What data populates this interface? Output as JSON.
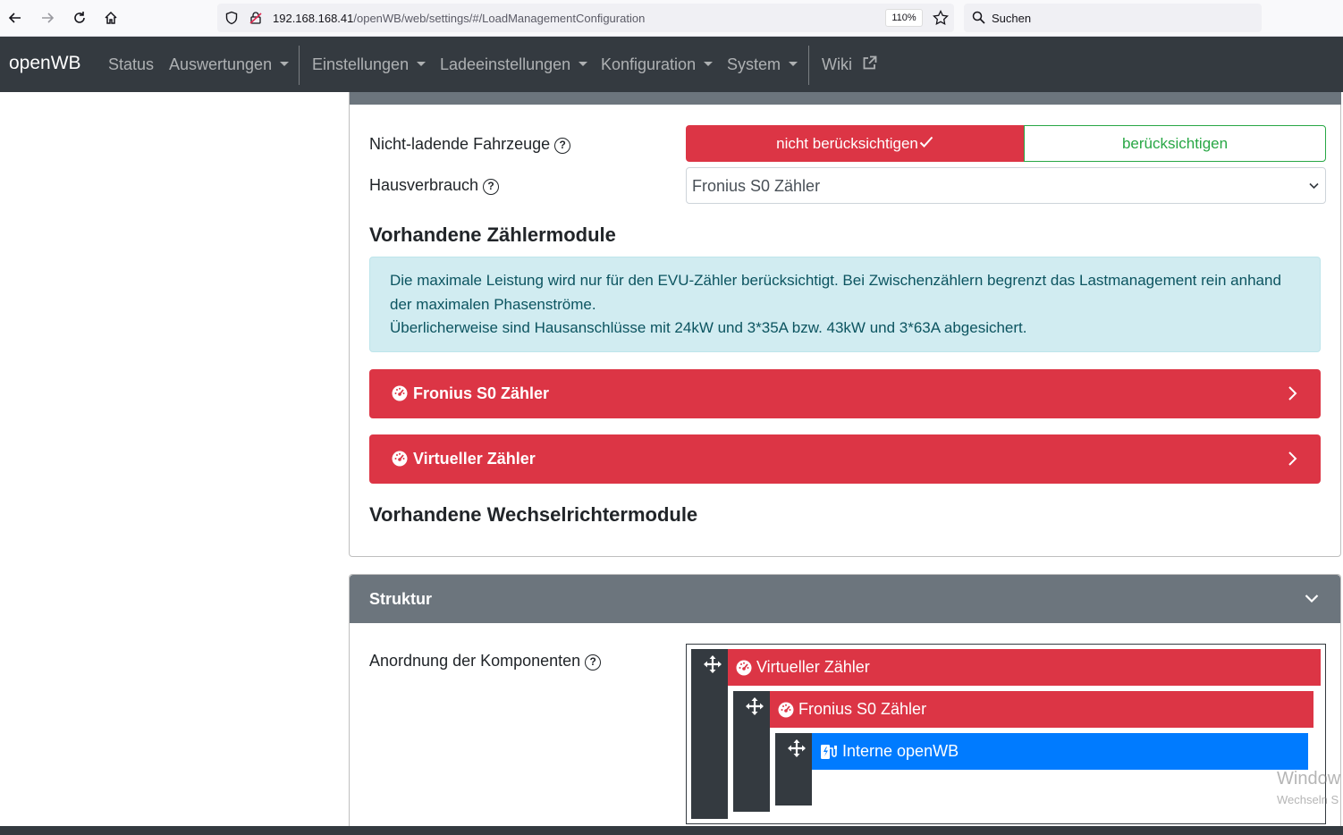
{
  "browser": {
    "url_host": "192.168.168.41",
    "url_path": "/openWB/web/settings/#/LoadManagementConfiguration",
    "zoom": "110%",
    "search_placeholder": "Suchen"
  },
  "navbar": {
    "brand": "openWB",
    "items": [
      {
        "label": "Status"
      },
      {
        "label": "Auswertungen"
      },
      {
        "label": "Einstellungen"
      },
      {
        "label": "Ladeeinstellungen"
      },
      {
        "label": "Konfiguration"
      },
      {
        "label": "System"
      },
      {
        "label": "Wiki"
      }
    ]
  },
  "settings": {
    "non_charging_label": "Nicht-ladende Fahrzeuge",
    "opt_not_consider": "nicht berücksichtigen",
    "opt_consider": "berücksichtigen",
    "house_label": "Hausverbrauch",
    "house_value": "Fronius S0 Zähler",
    "counter_modules_title": "Vorhandene Zählermodule",
    "info_text_1": "Die maximale Leistung wird nur für den EVU-Zähler berücksichtigt. Bei Zwischenzählern begrenzt das Lastmanagement rein anhand der maximalen Phasenströme.",
    "info_text_2": "Überlicherweise sind Hausanschlüsse mit 24kW und 3*35A bzw. 43kW und 3*63A abgesichert.",
    "counters": [
      {
        "label": "Fronius S0 Zähler"
      },
      {
        "label": "Virtueller Zähler"
      }
    ],
    "inverter_modules_title": "Vorhandene Wechselrichtermodule"
  },
  "structure": {
    "title": "Struktur",
    "arrangement_label": "Anordnung der Komponenten",
    "tree": [
      {
        "label": "Virtueller Zähler"
      },
      {
        "label": "Fronius S0 Zähler"
      },
      {
        "label": "Interne openWB"
      }
    ]
  },
  "watermark": {
    "line1": "Window",
    "line2": "Wechseln S"
  },
  "colors": {
    "danger": "#dc3545",
    "success": "#28a745",
    "primary": "#007bff",
    "dark": "#343a40",
    "secondary": "#6c757d",
    "info_bg": "#d1ecf1"
  }
}
